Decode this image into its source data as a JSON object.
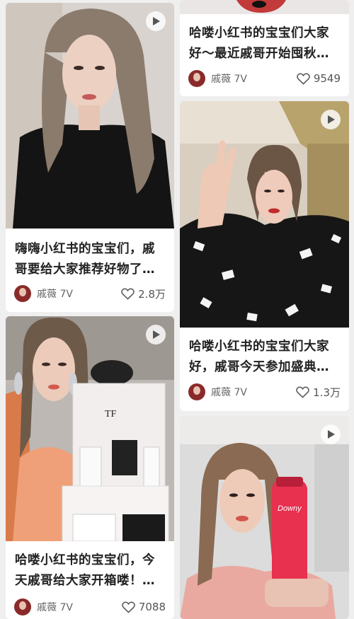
{
  "feed": {
    "cards": [
      {
        "title": "嗨嗨小红书的宝宝们，戚哥要给大家推荐好物了…",
        "author": "戚薇 7V",
        "likes": "2.8万",
        "thumb": "black-top-portrait"
      },
      {
        "title": "哈喽小红书的宝宝们，今天戚哥给大家开箱喽！…",
        "author": "戚薇 7V",
        "likes": "7088",
        "thumb": "tom-ford-unboxing"
      },
      {
        "title": "哈喽小红书的宝宝们大家好～最近戚哥开始囤秋…",
        "author": "戚薇 7V",
        "likes": "9549",
        "thumb": "partial-top"
      },
      {
        "title": "哈喽小红书的宝宝们大家好，戚哥今天参加盛典…",
        "author": "戚薇 7V",
        "likes": "1.3万",
        "thumb": "waving-polka-dress"
      },
      {
        "title": "",
        "author": "",
        "likes": "",
        "thumb": "downy-product"
      }
    ],
    "icons": {
      "play": "play-icon",
      "like": "heart-outline-icon"
    },
    "colors": {
      "accent": "#8a2a2a",
      "background": "#efefef"
    }
  }
}
